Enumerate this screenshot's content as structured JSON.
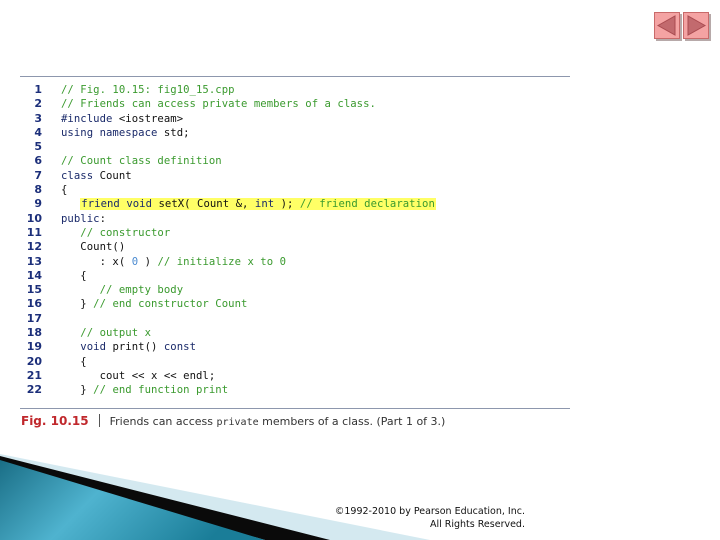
{
  "navigation": {
    "prev_icon": "left-triangle-icon",
    "next_icon": "right-triangle-icon"
  },
  "code": {
    "lines": [
      {
        "num": "1",
        "tokens": [
          {
            "t": "// Fig. 10.15: fig10_15.cpp",
            "c": "c"
          }
        ]
      },
      {
        "num": "2",
        "tokens": [
          {
            "t": "// Friends can access private members of a class.",
            "c": "c"
          }
        ]
      },
      {
        "num": "3",
        "tokens": [
          {
            "t": "#include",
            "c": "k"
          },
          {
            "t": " <iostream>",
            "c": "t"
          }
        ]
      },
      {
        "num": "4",
        "tokens": [
          {
            "t": "using",
            "c": "k"
          },
          {
            "t": " ",
            "c": "t"
          },
          {
            "t": "namespace",
            "c": "k"
          },
          {
            "t": " std;",
            "c": "t"
          }
        ]
      },
      {
        "num": "5",
        "tokens": []
      },
      {
        "num": "6",
        "tokens": [
          {
            "t": "// Count class definition",
            "c": "c"
          }
        ]
      },
      {
        "num": "7",
        "tokens": [
          {
            "t": "class",
            "c": "k"
          },
          {
            "t": " Count",
            "c": "t"
          }
        ]
      },
      {
        "num": "8",
        "tokens": [
          {
            "t": "{",
            "c": "t"
          }
        ]
      },
      {
        "num": "9",
        "indent": "   ",
        "highlight": true,
        "tokens": [
          {
            "t": "friend",
            "c": "k"
          },
          {
            "t": " ",
            "c": "t"
          },
          {
            "t": "void",
            "c": "k"
          },
          {
            "t": " setX( Count &, ",
            "c": "t"
          },
          {
            "t": "int",
            "c": "k"
          },
          {
            "t": " ); ",
            "c": "t"
          },
          {
            "t": "// friend declaration",
            "c": "c"
          }
        ]
      },
      {
        "num": "10",
        "tokens": [
          {
            "t": "public",
            "c": "k"
          },
          {
            "t": ":",
            "c": "t"
          }
        ]
      },
      {
        "num": "11",
        "indent": "   ",
        "tokens": [
          {
            "t": "// constructor",
            "c": "c"
          }
        ]
      },
      {
        "num": "12",
        "indent": "   ",
        "tokens": [
          {
            "t": "Count()",
            "c": "t"
          }
        ]
      },
      {
        "num": "13",
        "indent": "      ",
        "tokens": [
          {
            "t": ": x( ",
            "c": "t"
          },
          {
            "t": "0",
            "c": "n"
          },
          {
            "t": " ) ",
            "c": "t"
          },
          {
            "t": "// initialize x to 0",
            "c": "c"
          }
        ]
      },
      {
        "num": "14",
        "indent": "   ",
        "tokens": [
          {
            "t": "{",
            "c": "t"
          }
        ]
      },
      {
        "num": "15",
        "indent": "      ",
        "tokens": [
          {
            "t": "// empty body",
            "c": "c"
          }
        ]
      },
      {
        "num": "16",
        "indent": "   ",
        "tokens": [
          {
            "t": "} ",
            "c": "t"
          },
          {
            "t": "// end constructor Count",
            "c": "c"
          }
        ]
      },
      {
        "num": "17",
        "tokens": []
      },
      {
        "num": "18",
        "indent": "   ",
        "tokens": [
          {
            "t": "// output x",
            "c": "c"
          }
        ]
      },
      {
        "num": "19",
        "indent": "   ",
        "tokens": [
          {
            "t": "void",
            "c": "k"
          },
          {
            "t": " print() ",
            "c": "t"
          },
          {
            "t": "const",
            "c": "k"
          }
        ]
      },
      {
        "num": "20",
        "indent": "   ",
        "tokens": [
          {
            "t": "{",
            "c": "t"
          }
        ]
      },
      {
        "num": "21",
        "indent": "      ",
        "tokens": [
          {
            "t": "cout << x << endl;",
            "c": "t"
          }
        ]
      },
      {
        "num": "22",
        "indent": "   ",
        "tokens": [
          {
            "t": "} ",
            "c": "t"
          },
          {
            "t": "// end function print",
            "c": "c"
          }
        ]
      }
    ]
  },
  "caption": {
    "figure_label": "Fig. 10.15",
    "text_before": "Friends can access ",
    "text_code": "private",
    "text_after": " members of a class. (Part 1 of 3.)"
  },
  "footer": {
    "copyright_line1": "©1992-2010 by Pearson Education, Inc.",
    "copyright_line2": "All Rights Reserved."
  },
  "colors": {
    "comment": "#3a9a2e",
    "keyword": "#1a2a6a",
    "number": "#4a8ad0",
    "line_number": "#1c2f7a",
    "highlight": "#ffff66",
    "figure_label": "#c0282c",
    "nav_button": "#f4a3a3"
  }
}
